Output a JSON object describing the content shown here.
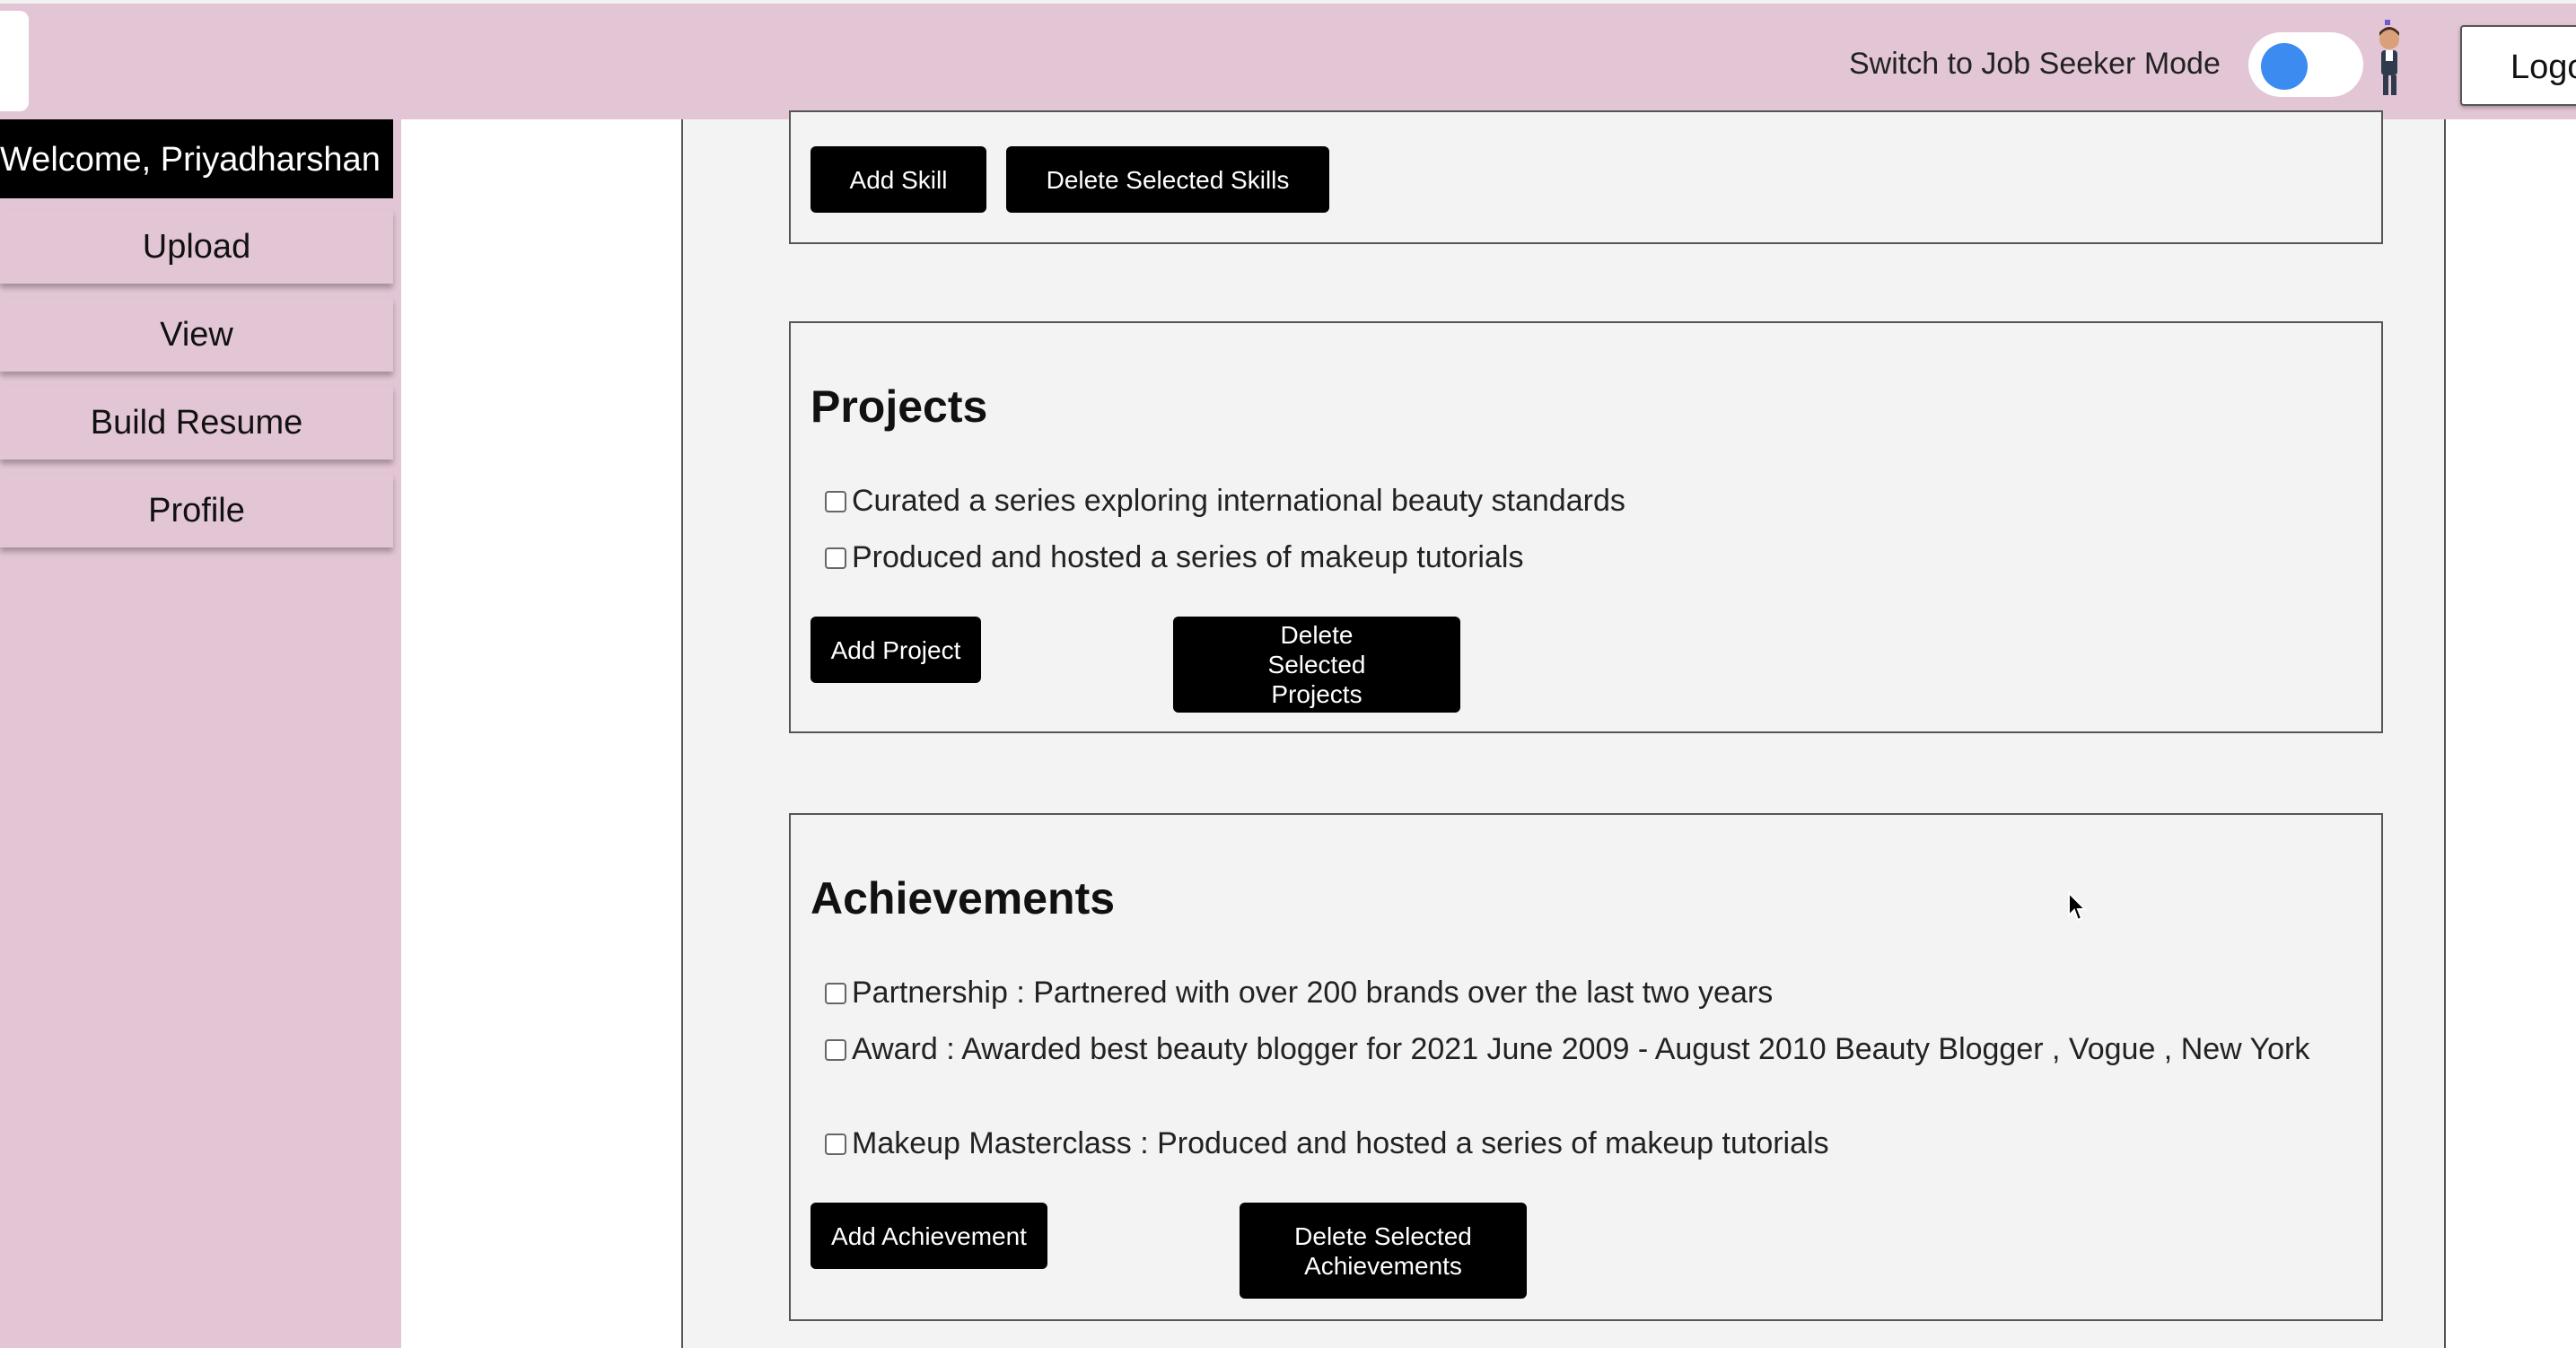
{
  "header": {
    "mode_label": "Switch to Job Seeker Mode",
    "toggle_color": "#3b8bf0",
    "logout_label": "Logout"
  },
  "sidebar": {
    "welcome": "Welcome, Priyadharshan",
    "items": [
      {
        "label": "Upload"
      },
      {
        "label": "View"
      },
      {
        "label": "Build Resume"
      },
      {
        "label": "Profile"
      }
    ]
  },
  "skills": {
    "add_label": "Add Skill",
    "delete_label": "Delete Selected Skills"
  },
  "projects": {
    "title": "Projects",
    "items": [
      "Curated a series exploring international beauty standards",
      "Produced and hosted a series of makeup tutorials"
    ],
    "add_label": "Add Project",
    "delete_label": "Delete Selected Projects"
  },
  "achievements": {
    "title": "Achievements",
    "items": [
      "Partnership : Partnered with over 200 brands over the last two years",
      "Award : Awarded best beauty blogger for 2021 June 2009 - August 2010 Beauty Blogger , Vogue , New York",
      "Makeup Masterclass : Produced and hosted a series of makeup tutorials"
    ],
    "add_label": "Add Achievement",
    "delete_label": "Delete Selected Achievements"
  },
  "colors": {
    "bar_bg": "#e3c6d5",
    "button_bg": "#000000",
    "content_bg": "#f3f3f3"
  }
}
